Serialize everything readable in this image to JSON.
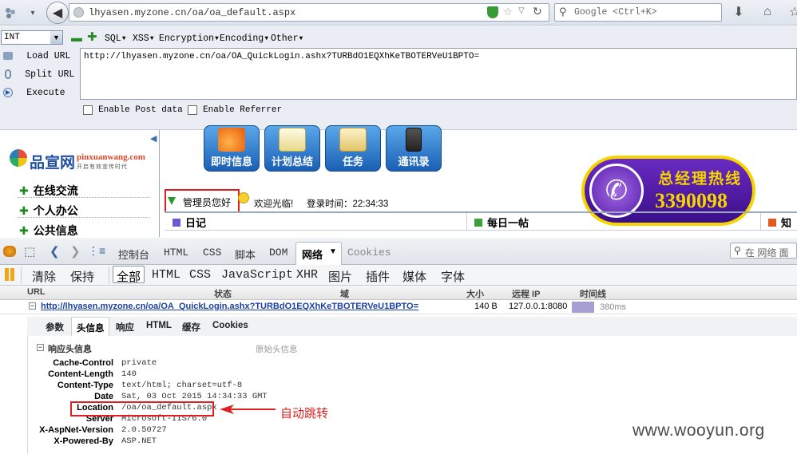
{
  "browser": {
    "url": "lhyasen.myzone.cn/oa/oa_default.aspx",
    "search_placeholder": "Google <Ctrl+K>"
  },
  "hackbar": {
    "type_select": "INT",
    "menus": [
      "SQL",
      "XSS",
      "Encryption",
      "Encoding",
      "Other"
    ],
    "side_buttons": [
      "Load URL",
      "Split URL",
      "Execute"
    ],
    "url_text": "http://lhyasen.myzone.cn/oa/OA_QuickLogin.ashx?TURBdO1EQXhKeTBOTERVeU1BPTO=",
    "enable_post": "Enable Post data",
    "enable_referrer": "Enable Referrer"
  },
  "webpage": {
    "logo_cn": "品宣网",
    "logo_en": "pinxuanwang.com",
    "logo_tagline": "开启有效宣传时代",
    "left_menu": [
      "在线交流",
      "个人办公",
      "公共信息"
    ],
    "buttons": [
      "即时信息",
      "计划总结",
      "任务",
      "通讯录"
    ],
    "admin_greeting": "管理员您好",
    "welcome": "欢迎光临!",
    "login_time": "登录时间：22:34:33",
    "hotline_label": "总经理热线",
    "hotline_number": "3390098",
    "bottom_tabs": [
      "日记",
      "每日一帖",
      "知"
    ]
  },
  "firebug": {
    "tabs": [
      "控制台",
      "HTML",
      "CSS",
      "脚本",
      "DOM",
      "网络",
      "Cookies"
    ],
    "active_tab": "网络",
    "search_placeholder": "在 网络 面",
    "subtabs": [
      "清除",
      "保持",
      "全部",
      "HTML",
      "CSS",
      "JavaScript",
      "XHR",
      "图片",
      "插件",
      "媒体",
      "字体"
    ],
    "active_subtab": "全部",
    "columns": [
      "URL",
      "状态",
      "域",
      "大小",
      "远程 IP",
      "时间线"
    ],
    "request": {
      "url": "http://lhyasen.myzone.cn/oa/OA_QuickLogin.ashx?TURBdO1EQXhKeTBOTERVeU1BPTO=",
      "size": "140 B",
      "remote_ip": "127.0.0.1:8080",
      "time": "380ms"
    },
    "detail_tabs": [
      "参数",
      "头信息",
      "响应",
      "HTML",
      "缓存",
      "Cookies"
    ],
    "active_detail_tab": "头信息",
    "section_title": "响应头信息",
    "raw_link": "原始头信息",
    "headers": [
      {
        "k": "Cache-Control",
        "v": "private"
      },
      {
        "k": "Content-Length",
        "v": "140"
      },
      {
        "k": "Content-Type",
        "v": "text/html; charset=utf-8"
      },
      {
        "k": "Date",
        "v": "Sat, 03 Oct 2015 14:34:33 GMT"
      },
      {
        "k": "Location",
        "v": "/oa/oa_default.aspx"
      },
      {
        "k": "Server",
        "v": "Microsoft-IIS/6.0"
      },
      {
        "k": "X-AspNet-Version",
        "v": "2.0.50727"
      },
      {
        "k": "X-Powered-By",
        "v": "ASP.NET"
      }
    ],
    "annotation": "自动跳转"
  },
  "watermark": "www.wooyun.org"
}
